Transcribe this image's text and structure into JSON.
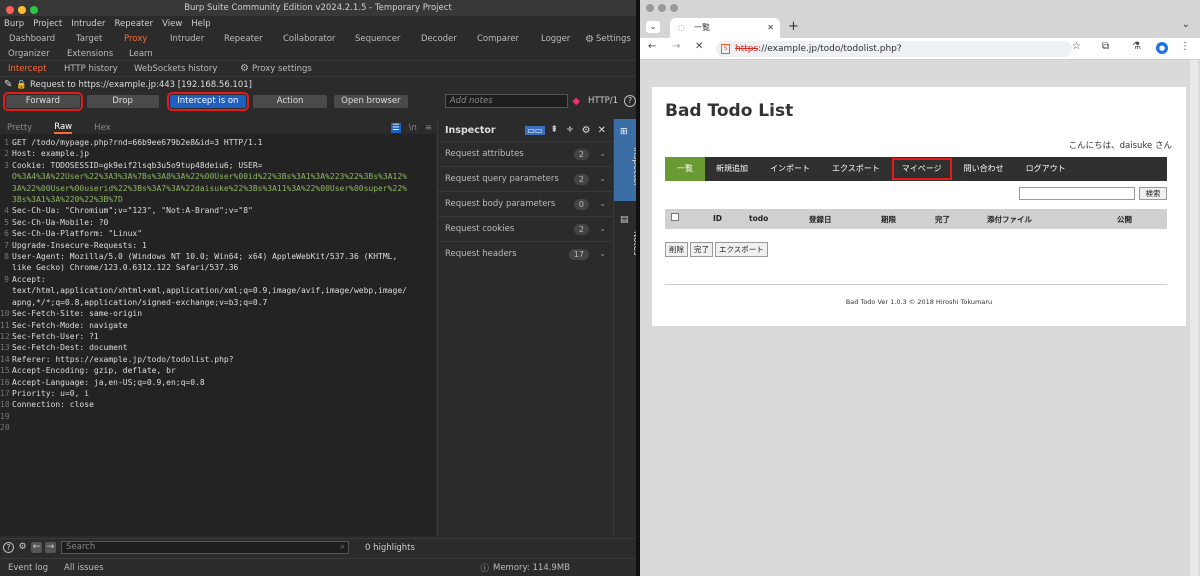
{
  "burp": {
    "window_title": "Burp Suite Community Edition v2024.2.1.5 - Temporary Project",
    "menu": [
      "Burp",
      "Project",
      "Intruder",
      "Repeater",
      "View",
      "Help"
    ],
    "tabs_row1": [
      "Dashboard",
      "Target",
      "Proxy",
      "Intruder",
      "Repeater",
      "Collaborator",
      "Sequencer",
      "Decoder",
      "Comparer",
      "Logger"
    ],
    "settings_label": "Settings",
    "tabs_row2": [
      "Organizer",
      "Extensions",
      "Learn"
    ],
    "proxy_tabs": [
      "Intercept",
      "HTTP history",
      "WebSockets history"
    ],
    "proxy_settings_label": "Proxy settings",
    "request_to": "Request to https://example.jp:443  [192.168.56.101]",
    "buttons": {
      "forward": "Forward",
      "drop": "Drop",
      "intercept": "Intercept is on",
      "action": "Action",
      "open_browser": "Open browser"
    },
    "notes_placeholder": "Add notes",
    "http_version": "HTTP/1",
    "editor_tabs": [
      "Pretty",
      "Raw",
      "Hex"
    ],
    "newline_icon_label": "\\n",
    "request_lines": [
      {
        "n": "1",
        "text": "GET /todo/mypage.php?rnd=66b9ee679b2e8&id=3 HTTP/1.1"
      },
      {
        "n": "2",
        "text": "Host: example.jp"
      },
      {
        "n": "3",
        "text": "Cookie: TODOSESSID=gk9eif2lsqb3u5o9tup48deiu6; USER="
      },
      {
        "n": "",
        "text": "O%3A4%3A%22User%22%3A3%3A%7Bs%3A8%3A%22%00User%00id%22%3Bs%3A1%3A%223%22%3Bs%3A12%"
      },
      {
        "n": "",
        "text": "3A%22%00User%00userid%22%3Bs%3A7%3A%22daisuke%22%3Bs%3A11%3A%22%00User%00super%22%"
      },
      {
        "n": "",
        "text": "3Bs%3A1%3A%220%22%3B%7D"
      },
      {
        "n": "4",
        "text": "Sec-Ch-Ua: \"Chromium\";v=\"123\", \"Not:A-Brand\";v=\"8\""
      },
      {
        "n": "5",
        "text": "Sec-Ch-Ua-Mobile: ?0"
      },
      {
        "n": "6",
        "text": "Sec-Ch-Ua-Platform: \"Linux\""
      },
      {
        "n": "7",
        "text": "Upgrade-Insecure-Requests: 1"
      },
      {
        "n": "8",
        "text": "User-Agent: Mozilla/5.0 (Windows NT 10.0; Win64; x64) AppleWebKit/537.36 (KHTML,"
      },
      {
        "n": "",
        "text": "like Gecko) Chrome/123.0.6312.122 Safari/537.36"
      },
      {
        "n": "9",
        "text": "Accept:"
      },
      {
        "n": "",
        "text": "text/html,application/xhtml+xml,application/xml;q=0.9,image/avif,image/webp,image/"
      },
      {
        "n": "",
        "text": "apng,*/*;q=0.8,application/signed-exchange;v=b3;q=0.7"
      },
      {
        "n": "10",
        "text": "Sec-Fetch-Site: same-origin"
      },
      {
        "n": "11",
        "text": "Sec-Fetch-Mode: navigate"
      },
      {
        "n": "12",
        "text": "Sec-Fetch-User: ?1"
      },
      {
        "n": "13",
        "text": "Sec-Fetch-Dest: document"
      },
      {
        "n": "14",
        "text": "Referer: https://example.jp/todo/todolist.php?"
      },
      {
        "n": "15",
        "text": "Accept-Encoding: gzip, deflate, br"
      },
      {
        "n": "16",
        "text": "Accept-Language: ja,en-US;q=0.9,en;q=0.8"
      },
      {
        "n": "17",
        "text": "Priority: u=0, i"
      },
      {
        "n": "18",
        "text": "Connection: close"
      },
      {
        "n": "19",
        "text": ""
      },
      {
        "n": "20",
        "text": ""
      }
    ],
    "inspector": {
      "title": "Inspector",
      "items": [
        {
          "label": "Request attributes",
          "count": "2"
        },
        {
          "label": "Request query parameters",
          "count": "2"
        },
        {
          "label": "Request body parameters",
          "count": "0"
        },
        {
          "label": "Request cookies",
          "count": "2"
        },
        {
          "label": "Request headers",
          "count": "17"
        }
      ]
    },
    "side_tabs": [
      "Inspector",
      "Notes"
    ],
    "search_placeholder": "Search",
    "highlights": "0 highlights",
    "event_log": "Event log",
    "all_issues": "All issues",
    "memory": "Memory: 114.9MB"
  },
  "browser": {
    "tab_title": "一覧",
    "url_scheme": "https",
    "url_rest": "://example.jp/todo/todolist.php?",
    "page": {
      "title": "Bad Todo List",
      "greeting": "こんにちは、daisuke さん",
      "nav": [
        "一覧",
        "新規追加",
        "インポート",
        "エクスポート",
        "マイページ",
        "問い合わせ",
        "ログアウト"
      ],
      "search_button": "検索",
      "columns": [
        "ID",
        "todo",
        "登録日",
        "期限",
        "完了",
        "添付ファイル",
        "公開"
      ],
      "actions": [
        "削除",
        "完了",
        "エクスポート"
      ],
      "footer": "Bad Todo Ver 1.0.3 © 2018 Hiroshi Tokumaru"
    }
  },
  "colors": {
    "accent_orange": "#ff6633",
    "intercept_blue": "#1f5fbf",
    "highlight_red": "#e31b1b",
    "nav_active": "#6b9a32"
  }
}
